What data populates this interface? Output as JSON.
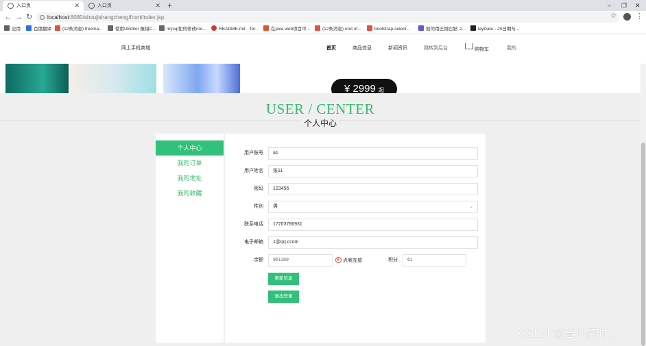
{
  "browser": {
    "tabs": [
      {
        "title": "入口页",
        "active": true
      },
      {
        "title": "入口页",
        "active": false
      }
    ],
    "new_tab": "+",
    "window_controls": {
      "minimize": "–",
      "restore": "❐",
      "close": "✕"
    },
    "url_host": "localhost",
    "url_path": ":8080/shoujishangcheng/front/index.jsp",
    "bookmarks": [
      {
        "label": "应用",
        "color": "#5f6368"
      },
      {
        "label": "百度翻译",
        "color": "#2b6fe0"
      },
      {
        "label": "(12条消息) freema...",
        "color": "#e2533a"
      },
      {
        "label": "使用UEditor 报错C...",
        "color": "#666666"
      },
      {
        "label": "mysql如何修改roo...",
        "color": "#666666"
      },
      {
        "label": "README.md · Ter...",
        "color": "#d9362b"
      },
      {
        "label": "在java web项目中...",
        "color": "#e2533a"
      },
      {
        "label": "(12条消息) root of...",
        "color": "#e2533a"
      },
      {
        "label": "bootstrap-select...",
        "color": "#e2533a"
      },
      {
        "label": "如何用正则匹配: 2...",
        "color": "#5b5bd6"
      },
      {
        "label": "layDate - JS日期与...",
        "color": "#222222"
      }
    ]
  },
  "site": {
    "brand": "网上手机商城",
    "nav": [
      "首页",
      "商品信息",
      "新闻资讯",
      "跳转到后台",
      "购物车",
      "我的"
    ],
    "banner_price": "¥ 2999",
    "banner_price_suffix": "起",
    "hero_en": "USER / CENTER",
    "hero_cn": "个人中心",
    "menu": [
      {
        "label": "个人中心",
        "active": true
      },
      {
        "label": "我的订单",
        "active": false
      },
      {
        "label": "我的地址",
        "active": false
      },
      {
        "label": "我的收藏",
        "active": false
      }
    ],
    "form": {
      "account_label": "用户账号",
      "account_value": "a1",
      "name_label": "用户姓名",
      "name_value": "张11",
      "password_label": "密码",
      "password_value": "123456",
      "gender_label": "性别",
      "gender_value": "男",
      "phone_label": "联系电话",
      "phone_value": "17703786931",
      "email_label": "电子邮箱",
      "email_value": "1@qq.ccom",
      "balance_label": "余额",
      "balance_value": "961189",
      "recharge_label": "点我充值",
      "points_label": "积分",
      "points_value": "61",
      "update_button": "更新信息",
      "logout_button": "退出登录"
    },
    "watermark": "CSDN @曾几何时…"
  },
  "colors": {
    "accent": "#32c07a",
    "hero_text": "#3cba6f",
    "page_bg": "#efefef"
  }
}
